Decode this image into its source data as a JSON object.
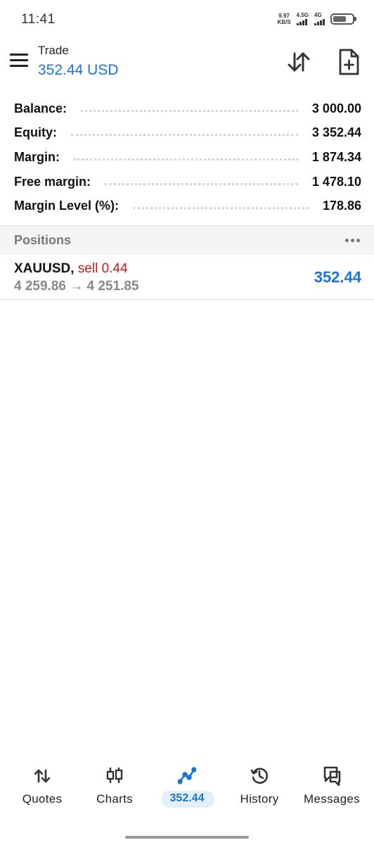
{
  "status_bar": {
    "time": "11:41",
    "speed_value": "9.97",
    "speed_unit": "KB/S",
    "network_1": "4.5G",
    "network_2": "4G"
  },
  "header": {
    "title": "Trade",
    "subtitle": "352.44 USD"
  },
  "account": {
    "rows": [
      {
        "label": "Balance:",
        "value": "3 000.00"
      },
      {
        "label": "Equity:",
        "value": "3 352.44"
      },
      {
        "label": "Margin:",
        "value": "1 874.34"
      },
      {
        "label": "Free margin:",
        "value": "1 478.10"
      },
      {
        "label": "Margin Level (%):",
        "value": "178.86"
      }
    ]
  },
  "positions": {
    "title": "Positions",
    "items": [
      {
        "symbol": "XAUUSD,",
        "side": "sell 0.44",
        "prices": "4 259.86 → 4 251.85",
        "profit": "352.44"
      }
    ]
  },
  "bottom_nav": {
    "items": [
      {
        "label": "Quotes",
        "icon": "quotes-arrows-icon"
      },
      {
        "label": "Charts",
        "icon": "candlestick-icon"
      },
      {
        "label": "352.44",
        "icon": "trade-line-icon",
        "active": true
      },
      {
        "label": "History",
        "icon": "history-clock-icon"
      },
      {
        "label": "Messages",
        "icon": "messages-icon"
      }
    ]
  },
  "colors": {
    "accent": "#1a73d9",
    "sell": "#c71a1a",
    "muted": "#888888"
  }
}
